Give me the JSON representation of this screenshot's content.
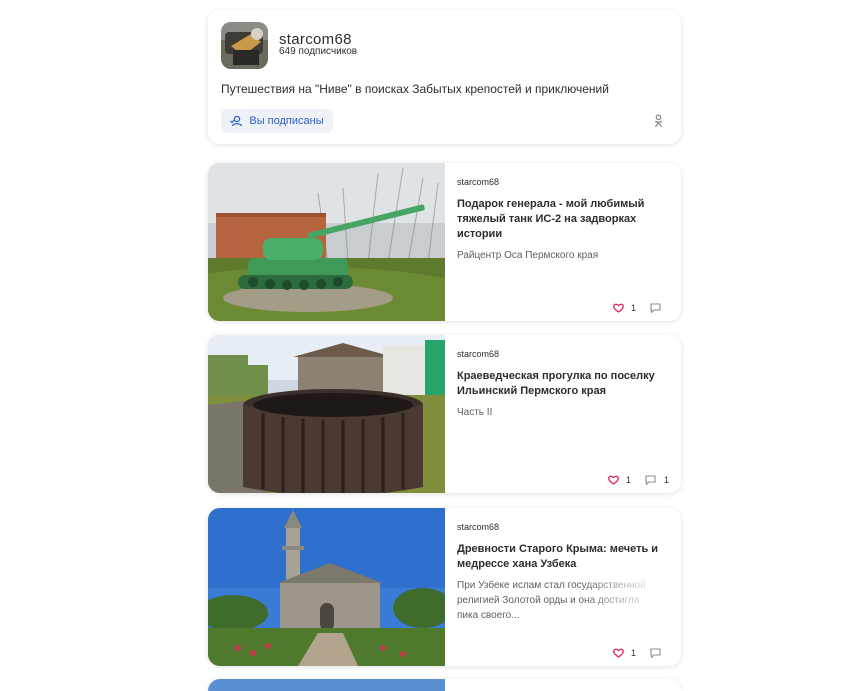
{
  "channel": {
    "name": "starcom68",
    "subscribers": "649 подписчиков",
    "description": "Путешествия на \"Ниве\" в поисках Забытых крепостей и приключений",
    "subscribe_label": "Вы подписаны",
    "share_icon": "odnoklassniki-icon",
    "accent_color": "#2c5fc8"
  },
  "articles": [
    {
      "author": "starcom68",
      "title": "Подарок генерала - мой любимый тяжелый танк ИС-2 на задворках истории",
      "subtitle": "Райцентр Оса Пермского края",
      "likes": "1",
      "comments": ""
    },
    {
      "author": "starcom68",
      "title": "Краеведческая прогулка по поселку Ильинский Пермского края",
      "subtitle": "Часть II",
      "likes": "1",
      "comments": "1"
    },
    {
      "author": "starcom68",
      "title": "Древности Старого Крыма: мечеть и медрессе хана Узбека",
      "subtitle": "При Узбеке ислам стал государственной религией Золотой орды и она достигла пика своего...",
      "likes": "1",
      "comments": ""
    }
  ],
  "like_color": "#e0245e"
}
